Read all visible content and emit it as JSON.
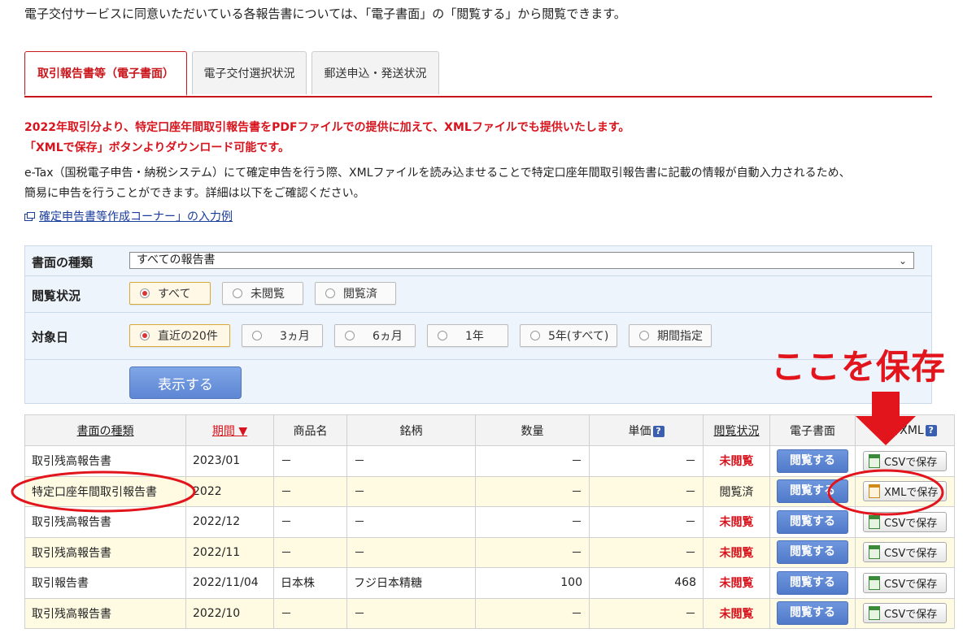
{
  "intro_text": "電子交付サービスに同意いただいている各報告書については、「電子書面」の「閲覧する」から閲覧できます。",
  "tabs": [
    {
      "label": "取引報告書等（電子書面）",
      "active": true
    },
    {
      "label": "電子交付選択状況",
      "active": false
    },
    {
      "label": "郵送申込・発送状況",
      "active": false
    }
  ],
  "notice": {
    "red_line1": "2022年取引分より、特定口座年間取引報告書をPDFファイルでの提供に加えて、XMLファイルでも提供いたします。",
    "red_line2": "「XMLで保存」ボタンよりダウンロード可能です。",
    "desc_line1": "e-Tax（国税電子申告・納税システム）にて確定申告を行う際、XMLファイルを読み込ませることで特定口座年間取引報告書に記載の情報が自動入力されるため、",
    "desc_line2": "簡易に申告を行うことができます。詳細は以下をご確認ください。",
    "link_text": "確定申告書等作成コーナー」の入力例"
  },
  "filter": {
    "doc_type_label": "書面の種類",
    "doc_type_value": "すべての報告書",
    "status_label": "閲覧状況",
    "status_options": [
      "すべて",
      "未閲覧",
      "閲覧済"
    ],
    "status_selected": 0,
    "date_label": "対象日",
    "date_options": [
      "直近の20件",
      "3ヵ月",
      "6ヵ月",
      "1年",
      "5年(すべて)",
      "期間指定"
    ],
    "date_selected": 0,
    "show_button": "表示する"
  },
  "table": {
    "headers": [
      "書面の種類",
      "期間 ▼",
      "商品名",
      "銘柄",
      "数量",
      "単価",
      "閲覧状況",
      "電子書面",
      "CSV/XML"
    ],
    "help_mark": "?",
    "view_label": "閲覧する",
    "rows": [
      {
        "type": "取引残高報告書",
        "period": "2023/01",
        "product": "－",
        "brand": "－",
        "qty": "－",
        "price": "－",
        "status": "未閲覧",
        "unread": true,
        "save": "CSVで保存"
      },
      {
        "type": "特定口座年間取引報告書",
        "period": "2022",
        "product": "－",
        "brand": "－",
        "qty": "－",
        "price": "－",
        "status": "閲覧済",
        "unread": false,
        "save": "XMLで保存"
      },
      {
        "type": "取引残高報告書",
        "period": "2022/12",
        "product": "－",
        "brand": "－",
        "qty": "－",
        "price": "－",
        "status": "未閲覧",
        "unread": true,
        "save": "CSVで保存"
      },
      {
        "type": "取引残高報告書",
        "period": "2022/11",
        "product": "－",
        "brand": "－",
        "qty": "－",
        "price": "－",
        "status": "未閲覧",
        "unread": true,
        "save": "CSVで保存"
      },
      {
        "type": "取引報告書",
        "period": "2022/11/04",
        "product": "日本株",
        "brand": "フジ日本精糖",
        "qty": "100",
        "price": "468",
        "status": "未閲覧",
        "unread": true,
        "save": "CSVで保存"
      },
      {
        "type": "取引残高報告書",
        "period": "2022/10",
        "product": "－",
        "brand": "－",
        "qty": "－",
        "price": "－",
        "status": "未閲覧",
        "unread": true,
        "save": "CSVで保存"
      }
    ]
  },
  "annotation": {
    "text": "ここを保存",
    "color": "#e2141c"
  },
  "colors": {
    "accent_red": "#c8161d",
    "button_blue": "#5d86d4",
    "filter_bg": "#eef4fb",
    "row_alt": "#fffbe3"
  }
}
